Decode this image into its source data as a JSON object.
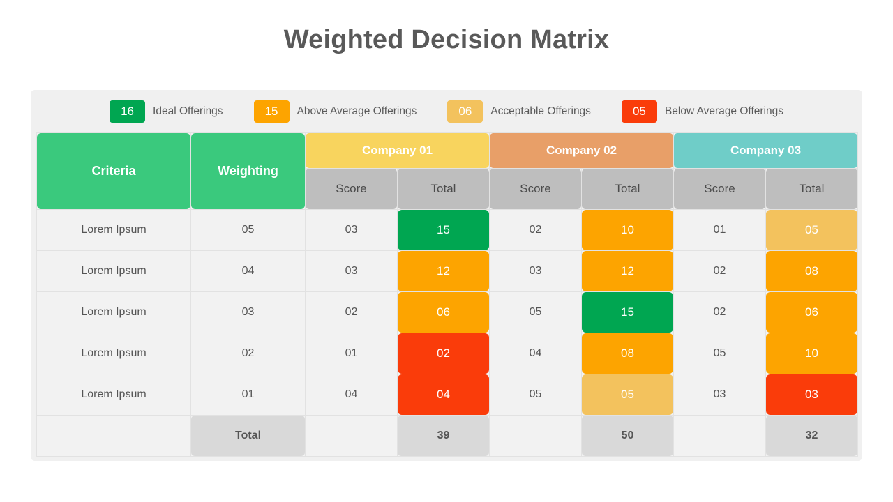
{
  "page": {
    "title": "Weighted Decision Matrix",
    "background": "#ffffff",
    "panel_background": "#f0f0f0",
    "title_color": "#595959"
  },
  "colors": {
    "ideal_green": "#00a651",
    "header_green": "#3ac97d",
    "above_average_orange": "#fda400",
    "acceptable_light_orange": "#f3c25d",
    "below_average_red": "#fa3c0a",
    "company01_header": "#f8d45e",
    "company02_header": "#e89f68",
    "company03_header": "#6fcdc8",
    "subheader_gray": "#bebebe",
    "total_gray": "#d9d9d9",
    "cell_background": "#f2f2f2"
  },
  "legend": {
    "items": [
      {
        "value": "16",
        "label": "Ideal Offerings",
        "color": "#00a651"
      },
      {
        "value": "15",
        "label": "Above Average Offerings",
        "color": "#fda400"
      },
      {
        "value": "06",
        "label": "Acceptable Offerings",
        "color": "#f3c25d"
      },
      {
        "value": "05",
        "label": "Below Average Offerings",
        "color": "#fa3c0a"
      }
    ]
  },
  "table": {
    "headers": {
      "criteria": "Criteria",
      "weighting": "Weighting",
      "score": "Score",
      "total": "Total",
      "total_label": "Total"
    },
    "companies": [
      {
        "name": "Company 01",
        "color": "#f8d45e"
      },
      {
        "name": "Company 02",
        "color": "#e89f68"
      },
      {
        "name": "Company 03",
        "color": "#6fcdc8"
      }
    ],
    "rows": [
      {
        "criteria": "Lorem Ipsum",
        "weighting": "05",
        "c1_score": "03",
        "c1_total": "15",
        "c1_color": "#00a651",
        "c2_score": "02",
        "c2_total": "10",
        "c2_color": "#fda400",
        "c3_score": "01",
        "c3_total": "05",
        "c3_color": "#f3c25d"
      },
      {
        "criteria": "Lorem Ipsum",
        "weighting": "04",
        "c1_score": "03",
        "c1_total": "12",
        "c1_color": "#fda400",
        "c2_score": "03",
        "c2_total": "12",
        "c2_color": "#fda400",
        "c3_score": "02",
        "c3_total": "08",
        "c3_color": "#fda400"
      },
      {
        "criteria": "Lorem Ipsum",
        "weighting": "03",
        "c1_score": "02",
        "c1_total": "06",
        "c1_color": "#fda400",
        "c2_score": "05",
        "c2_total": "15",
        "c2_color": "#00a651",
        "c3_score": "02",
        "c3_total": "06",
        "c3_color": "#fda400"
      },
      {
        "criteria": "Lorem Ipsum",
        "weighting": "02",
        "c1_score": "01",
        "c1_total": "02",
        "c1_color": "#fa3c0a",
        "c2_score": "04",
        "c2_total": "08",
        "c2_color": "#fda400",
        "c3_score": "05",
        "c3_total": "10",
        "c3_color": "#fda400"
      },
      {
        "criteria": "Lorem Ipsum",
        "weighting": "01",
        "c1_score": "04",
        "c1_total": "04",
        "c1_color": "#fa3c0a",
        "c2_score": "05",
        "c2_total": "05",
        "c2_color": "#f3c25d",
        "c3_score": "03",
        "c3_total": "03",
        "c3_color": "#fa3c0a"
      }
    ],
    "totals": {
      "company01": "39",
      "company02": "50",
      "company03": "32"
    }
  }
}
